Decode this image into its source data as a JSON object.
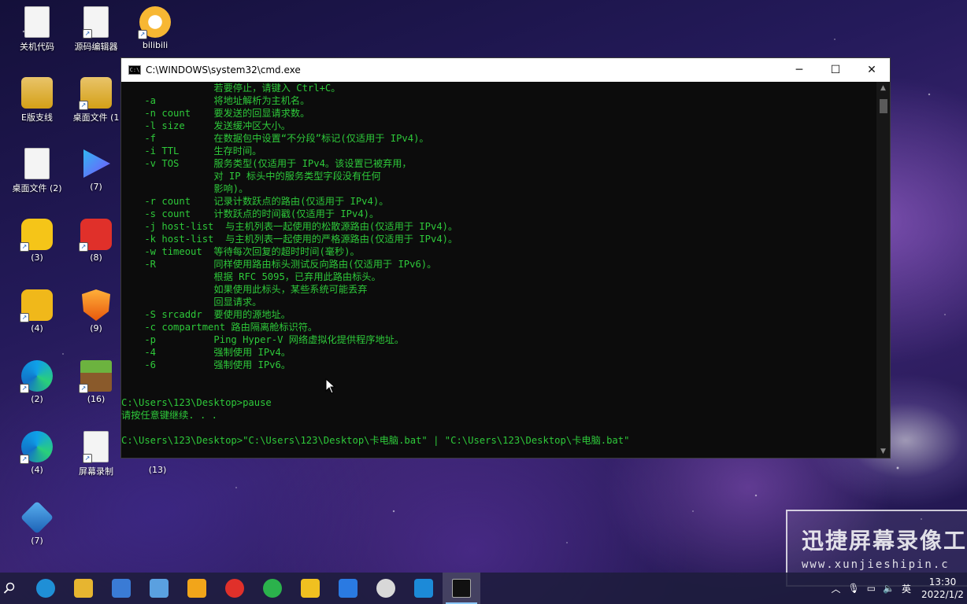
{
  "desktop_icons": [
    {
      "label": "关机代码",
      "icon": "document-icon"
    },
    {
      "label": "源码编辑器",
      "icon": "document-shortcut-icon"
    },
    {
      "label": "bilibili",
      "icon": "bilibili-icon"
    },
    {
      "label": "E版支线",
      "icon": "folder-icon"
    },
    {
      "label": "桌面文件 (1",
      "icon": "folder-icon"
    },
    {
      "label": "桌面文件 (2)",
      "icon": "document-icon"
    },
    {
      "label": "(7)",
      "icon": "video-player-icon"
    },
    {
      "label": "(3)",
      "icon": "app-icon"
    },
    {
      "label": "(8)",
      "icon": "netease-music-icon"
    },
    {
      "label": "(4)",
      "icon": "app-icon"
    },
    {
      "label": "(9)",
      "icon": "shield-icon"
    },
    {
      "label": "(2)",
      "icon": "edge-icon"
    },
    {
      "label": "(16)",
      "icon": "minecraft-icon"
    },
    {
      "label": "(4)",
      "icon": "edge-icon"
    },
    {
      "label": "屏幕录制",
      "icon": "document-shortcut-icon"
    },
    {
      "label": "(13)",
      "icon": "hidden-icon"
    },
    {
      "label": "(7)",
      "icon": "cube-icon"
    }
  ],
  "window": {
    "title": "C:\\WINDOWS\\system32\\cmd.exe",
    "minimize": "─",
    "maximize": "☐",
    "close": "✕"
  },
  "console_lines": [
    "                若要停止，请键入 Ctrl+C。",
    "    -a          将地址解析为主机名。",
    "    -n count    要发送的回显请求数。",
    "    -l size     发送缓冲区大小。",
    "    -f          在数据包中设置“不分段”标记(仅适用于 IPv4)。",
    "    -i TTL      生存时间。",
    "    -v TOS      服务类型(仅适用于 IPv4。该设置已被弃用，",
    "                对 IP 标头中的服务类型字段没有任何",
    "                影响)。",
    "    -r count    记录计数跃点的路由(仅适用于 IPv4)。",
    "    -s count    计数跃点的时间戳(仅适用于 IPv4)。",
    "    -j host-list  与主机列表一起使用的松散源路由(仅适用于 IPv4)。",
    "    -k host-list  与主机列表一起使用的严格源路由(仅适用于 IPv4)。",
    "    -w timeout  等待每次回复的超时时间(毫秒)。",
    "    -R          同样使用路由标头测试反向路由(仅适用于 IPv6)。",
    "                根据 RFC 5095，已弃用此路由标头。",
    "                如果使用此标头，某些系统可能丢弃",
    "                回显请求。",
    "    -S srcaddr  要使用的源地址。",
    "    -c compartment 路由隔离舱标识符。",
    "    -p          Ping Hyper-V 网络虚拟化提供程序地址。",
    "    -4          强制使用 IPv4。",
    "    -6          强制使用 IPv6。",
    "",
    "",
    "C:\\Users\\123\\Desktop>pause",
    "请按任意键继续. . .",
    "",
    "C:\\Users\\123\\Desktop>\"C:\\Users\\123\\Desktop\\卡电脑.bat\" | \"C:\\Users\\123\\Desktop\\卡电脑.bat\""
  ],
  "watermark": {
    "title": "迅捷屏幕录像工",
    "url": "www.xunjieshipin.c"
  },
  "taskbar": {
    "apps": [
      {
        "name": "edge",
        "color": "#1f8fd6"
      },
      {
        "name": "file-explorer",
        "color": "#e7b530"
      },
      {
        "name": "store",
        "color": "#3a7bd5"
      },
      {
        "name": "control-panel",
        "color": "#5aa0e0"
      },
      {
        "name": "security",
        "color": "#f2a51a"
      },
      {
        "name": "netease-music",
        "color": "#e0302a"
      },
      {
        "name": "wechat",
        "color": "#2bb24c"
      },
      {
        "name": "qq-browser",
        "color": "#f0c020"
      },
      {
        "name": "feishu",
        "color": "#2a7ae2"
      },
      {
        "name": "clock-app",
        "color": "#d8d8d8"
      },
      {
        "name": "video-app",
        "color": "#1c8ad8"
      },
      {
        "name": "cmd",
        "color": "#111111"
      }
    ],
    "tray": {
      "ime": "英",
      "time": "13:30",
      "date": "2022/1/2"
    }
  }
}
